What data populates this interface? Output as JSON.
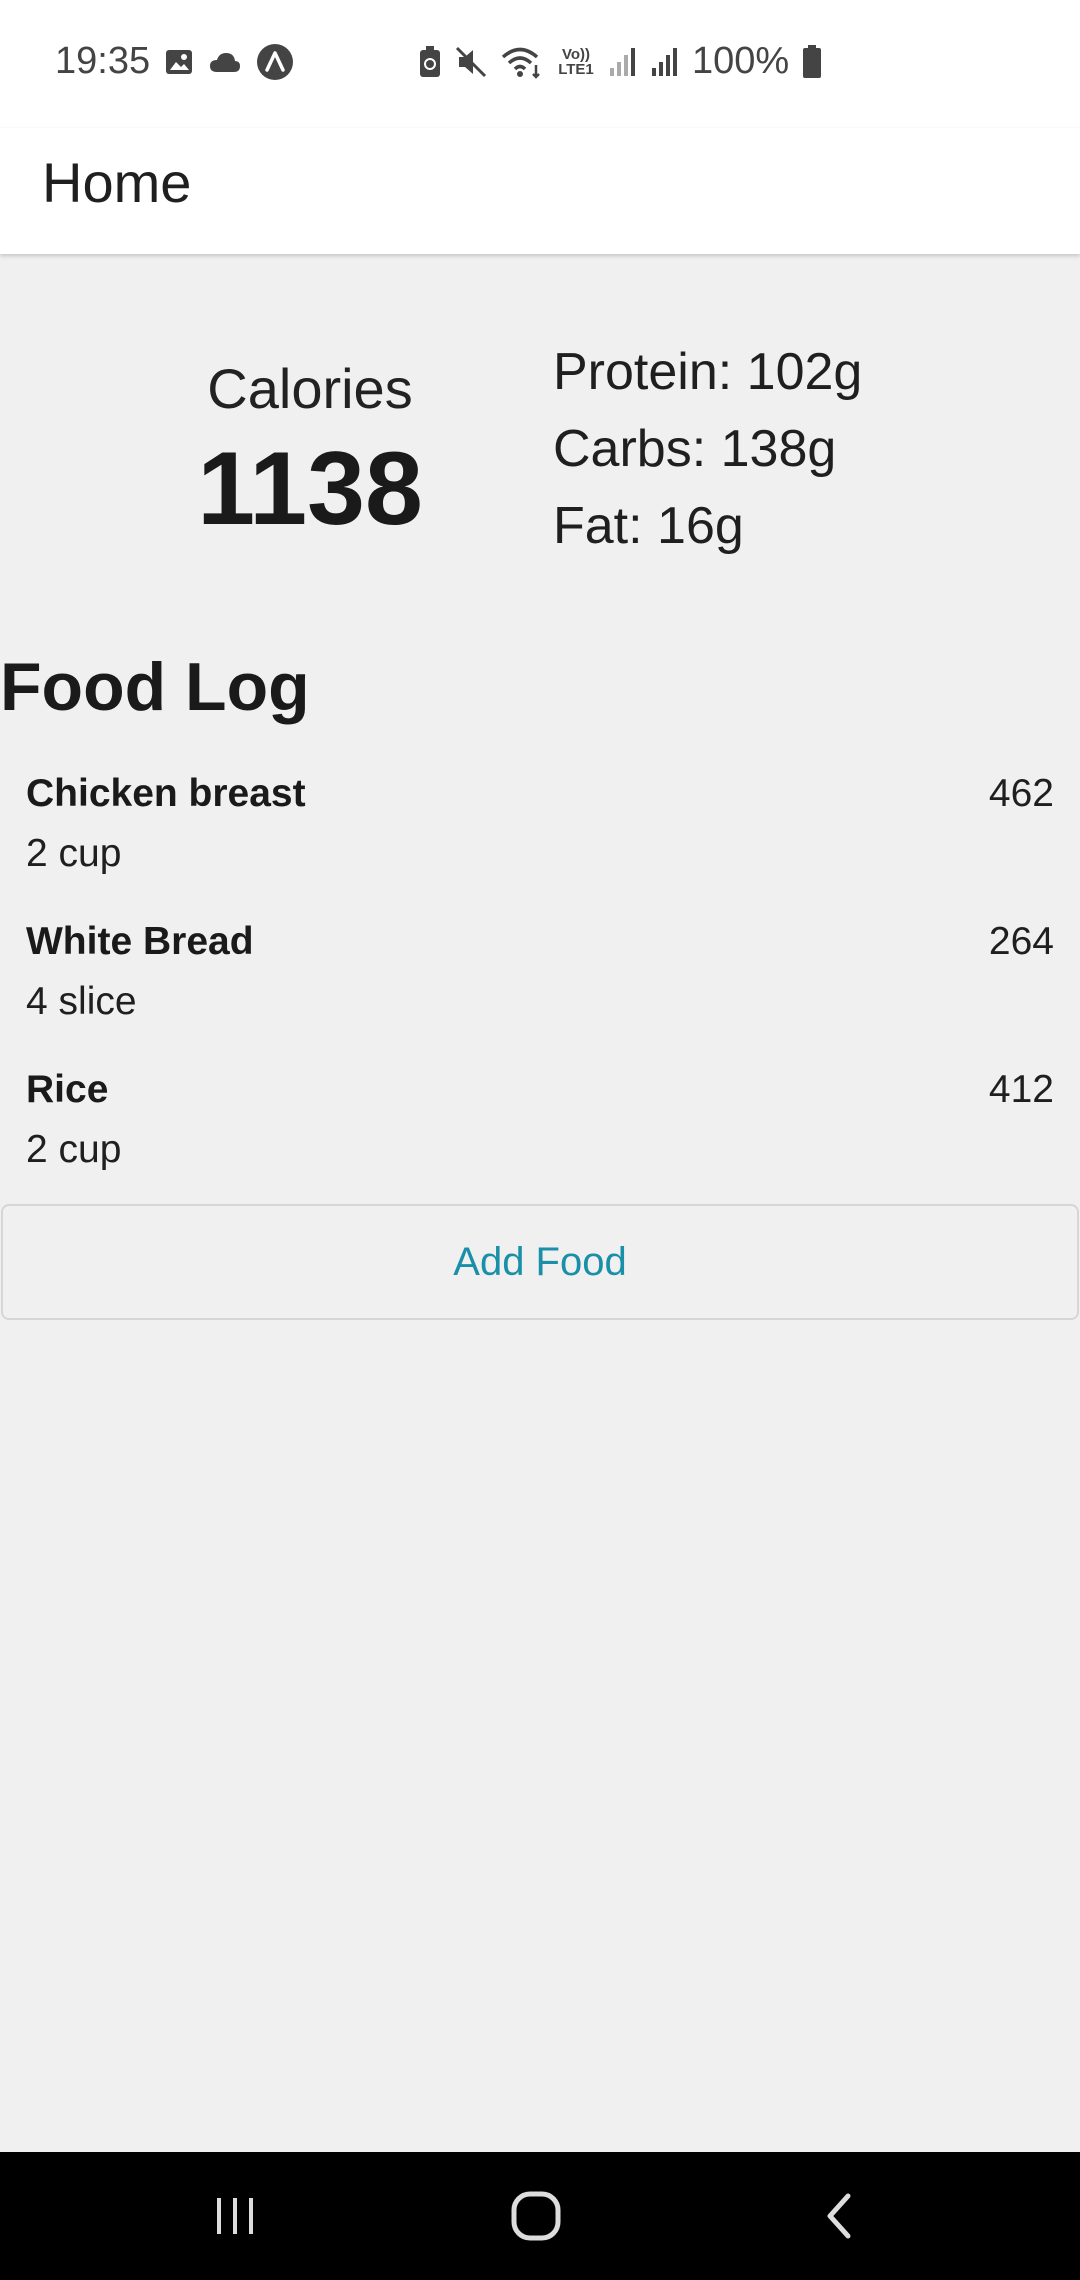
{
  "status": {
    "time": "19:35",
    "battery": "100%",
    "left_icons": [
      "image-icon",
      "cloud-icon",
      "app-notification-icon"
    ],
    "right_icons": [
      "battery-saver-icon",
      "mute-icon",
      "wifi-icon",
      "volte-icon",
      "signal-icon",
      "signal-icon",
      "battery-icon"
    ],
    "volte_text": "Vo)) LTE1"
  },
  "app_bar": {
    "title": "Home"
  },
  "summary": {
    "calories_label": "Calories",
    "calories_value": "1138",
    "protein": "Protein: 102g",
    "carbs": "Carbs: 138g",
    "fat": "Fat: 16g"
  },
  "food_log": {
    "title": "Food Log",
    "items": [
      {
        "name": "Chicken breast",
        "quantity": "2 cup",
        "calories": "462"
      },
      {
        "name": "White Bread",
        "quantity": "4 slice",
        "calories": "264"
      },
      {
        "name": "Rice",
        "quantity": "2 cup",
        "calories": "412"
      }
    ],
    "add_label": "Add Food"
  },
  "nav": {
    "icons": [
      "recents-icon",
      "home-icon",
      "back-icon"
    ]
  },
  "colors": {
    "accent": "#1a8fa8",
    "background": "#f0f0f0",
    "nav_bar": "#000000"
  }
}
